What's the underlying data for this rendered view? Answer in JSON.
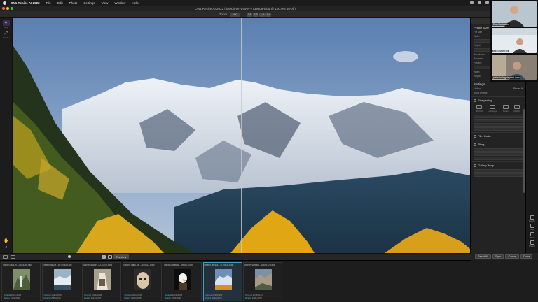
{
  "menubar": {
    "app": "ON1 Resize AI 2022",
    "items": [
      "File",
      "Edit",
      "Photo",
      "Settings",
      "View",
      "Window",
      "Help"
    ]
  },
  "window": {
    "title": "ON1 Resize AI 2022 (joseph-terry-ayyv-77398d8-t.jpg @ 100.0% 16-bit)"
  },
  "toolbar": {
    "zoom_label": "Zoom",
    "zoom_value": "100",
    "view_modes": [
      "1:1",
      "1:2",
      "1:3",
      "1:4"
    ]
  },
  "left_tools": [
    {
      "icon": "crop-icon",
      "glyph": "⌗",
      "label": "Crop"
    },
    {
      "icon": "resize-icon",
      "glyph": "⤢",
      "label": "Resize"
    }
  ],
  "right_panel": {
    "tabs": [
      "Size"
    ],
    "photo_size": {
      "title": "Photo Size",
      "rows": [
        {
          "k": "File size",
          "v": "69.8 MB"
        },
        {
          "k": "Width",
          "v": ""
        },
        {
          "k": "Height",
          "v": ""
        },
        {
          "k": "Resolution",
          "v": ""
        },
        {
          "k": "Resize to",
          "v": "Percent"
        },
        {
          "k": "Percent",
          "v": ""
        },
        {
          "k": "Width",
          "v": ""
        },
        {
          "k": "Height",
          "v": ""
        }
      ]
    },
    "settings": {
      "title": "Settings",
      "rows": [
        {
          "k": "Method",
          "v": "Resize AI"
        },
        {
          "k": "Show Photos",
          "v": ""
        }
      ],
      "sharpening": {
        "title": "Sharpening",
        "types": [
          "Portrait",
          "Landscape",
          "Detail",
          "Graphic"
        ]
      },
      "film_grain": {
        "title": "Film Grain"
      },
      "tiling": {
        "title": "Tiling"
      },
      "gallery_wrap": {
        "title": "Gallery Wrap"
      }
    }
  },
  "far_right": [
    {
      "icon": "resize-icon",
      "label": "Resize"
    },
    {
      "icon": "crop-icon",
      "label": "Crop"
    },
    {
      "icon": "print-icon",
      "label": "Print"
    },
    {
      "icon": "export-icon",
      "label": "Export"
    }
  ],
  "video_call": {
    "participants": [
      {
        "name": "Dan Harlacher"
      },
      {
        "name": "Craig Keudell"
      },
      {
        "name": "joshuthelrighleyomi.com"
      }
    ]
  },
  "filmbar": {
    "preview_label": "Preview"
  },
  "thumbnails": [
    {
      "filename": "joseph-falls-m...2803098-t.jpg",
      "original": "1024x1536",
      "resize": "1024x1536",
      "kind": "falls",
      "selected": false
    },
    {
      "filename": "joseph-glacie...8272083-t.jpg",
      "original": "1536x2048",
      "resize": "1536x2048",
      "kind": "glacier",
      "selected": false
    },
    {
      "filename": "joseph-glacie...8273102-t.jpg",
      "original": "1024x2048",
      "resize": "1024x2048",
      "kind": "glacier2",
      "selected": false
    },
    {
      "filename": "joseph-hank-ba...1165612-t.jpg",
      "original": "1920x2048",
      "resize": "1920x2048",
      "kind": "owl",
      "selected": false
    },
    {
      "filename": "joseph-pixabay...59085-9.jpg",
      "original": "1024x2048",
      "resize": "3065x8192",
      "kind": "eagle",
      "selected": false
    },
    {
      "filename": "joseph-terry-a...7739808-t.jpg",
      "original": "2048x1152",
      "resize": "8192x4608",
      "kind": "mountain",
      "selected": true
    },
    {
      "filename": "joseph-yanuka...1884912-t.jpg",
      "original": "2048x1152",
      "resize": "2048x1152",
      "kind": "valley",
      "selected": false
    }
  ],
  "thumb_labels": {
    "original": "Original",
    "resize": "Resize"
  },
  "actions": [
    "Reset All",
    "Sync",
    "Cancel",
    "Done"
  ],
  "colors": {
    "accent": "#3aa0c8",
    "selection": "#4db6d8"
  }
}
